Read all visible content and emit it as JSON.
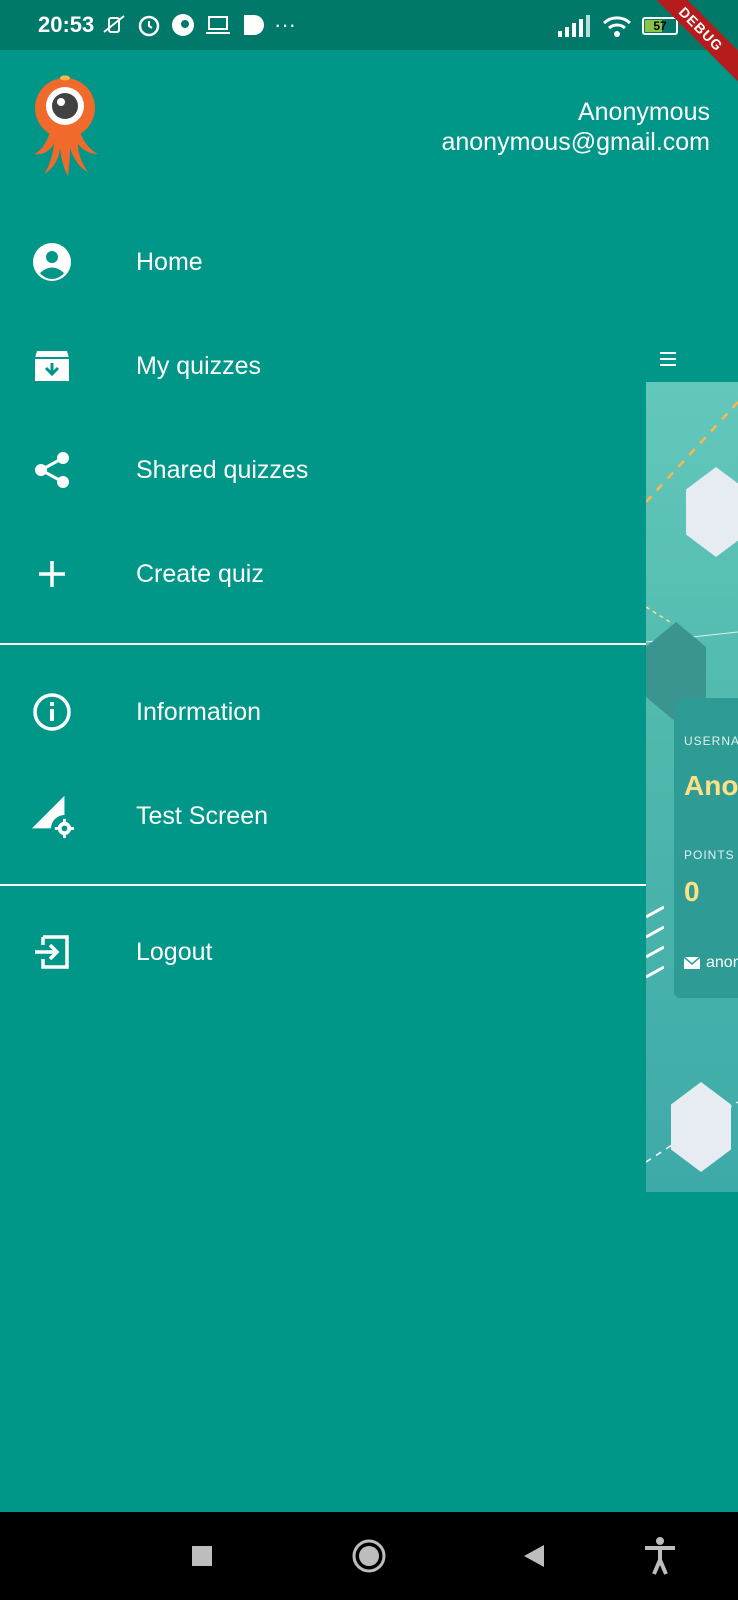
{
  "status_bar": {
    "time": "20:53",
    "battery": "57",
    "battery_level": 0.57
  },
  "debug_ribbon": "DEBUG",
  "drawer": {
    "user_name": "Anonymous",
    "user_email": "anonymous@gmail.com",
    "menu_items": [
      {
        "label": "Home",
        "icon": "account-circle-icon"
      },
      {
        "label": "My quizzes",
        "icon": "archive-icon"
      },
      {
        "label": "Shared quizzes",
        "icon": "share-icon"
      },
      {
        "label": "Create quiz",
        "icon": "plus-icon"
      },
      {
        "label": "Information",
        "icon": "info-icon"
      },
      {
        "label": "Test Screen",
        "icon": "network-settings-icon"
      },
      {
        "label": "Logout",
        "icon": "logout-icon"
      }
    ]
  },
  "main_peek": {
    "username_label": "USERNAM",
    "username_value": "Anon",
    "points_label": "POINTS",
    "points_value": "0",
    "email_fragment": "anon"
  },
  "colors": {
    "primary": "#009688",
    "primary_dark": "#00796b",
    "accent_yellow": "#ffe082",
    "logo_orange": "#f06a2c"
  }
}
